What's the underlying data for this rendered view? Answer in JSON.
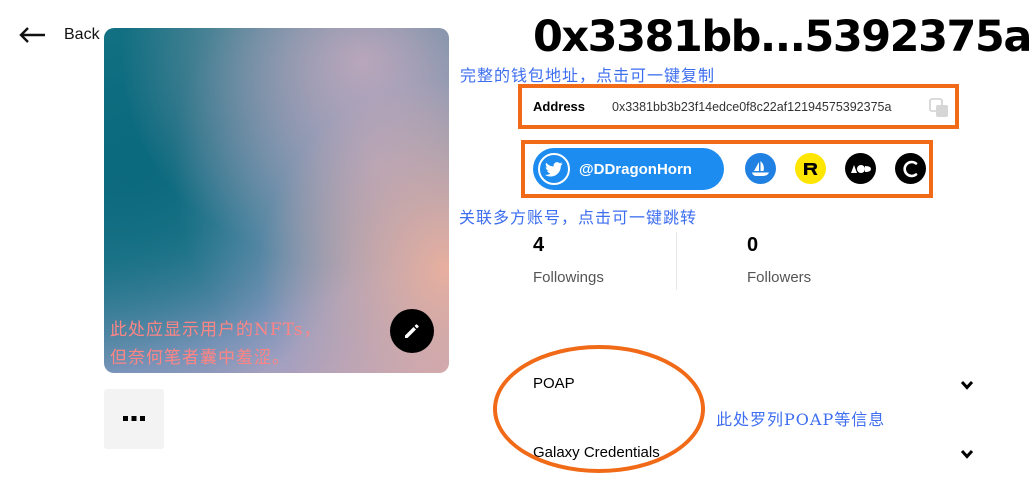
{
  "nav": {
    "back_label": "Back",
    "back_icon": "arrow-left-icon"
  },
  "profile": {
    "title": "0x3381bb...5392375a",
    "nft_note_line1": "此处应显示用户的NFTs，",
    "nft_note_line2": "但奈何笔者囊中羞涩。",
    "edit_icon": "pencil-icon",
    "more_icon": "more-dots-icon"
  },
  "annotations": {
    "address_note": "完整的钱包地址，点击可一键复制",
    "social_note": "关联多方账号，点击可一键跳转",
    "poap_note": "此处罗列POAP等信息"
  },
  "address": {
    "label": "Address",
    "value": "0x3381bb3b23f14edce0f8c22af12194575392375a",
    "copy_icon": "copy-icon"
  },
  "socials": {
    "twitter_handle": "@DDragonHorn",
    "twitter_icon": "twitter-icon",
    "links": [
      "opensea-icon",
      "rarible-icon",
      "looksrare-icon",
      "cyberconnect-icon"
    ]
  },
  "stats": {
    "followings_count": "4",
    "followings_label": "Followings",
    "followers_count": "0",
    "followers_label": "Followers"
  },
  "sections": {
    "poap_label": "POAP",
    "galaxy_label": "Galaxy Credentials"
  },
  "colors": {
    "accent_orange": "#f06a17",
    "annotation_blue": "#3d6ef0",
    "twitter_blue": "#1d8cf0",
    "nft_note_red": "#ff8585"
  }
}
